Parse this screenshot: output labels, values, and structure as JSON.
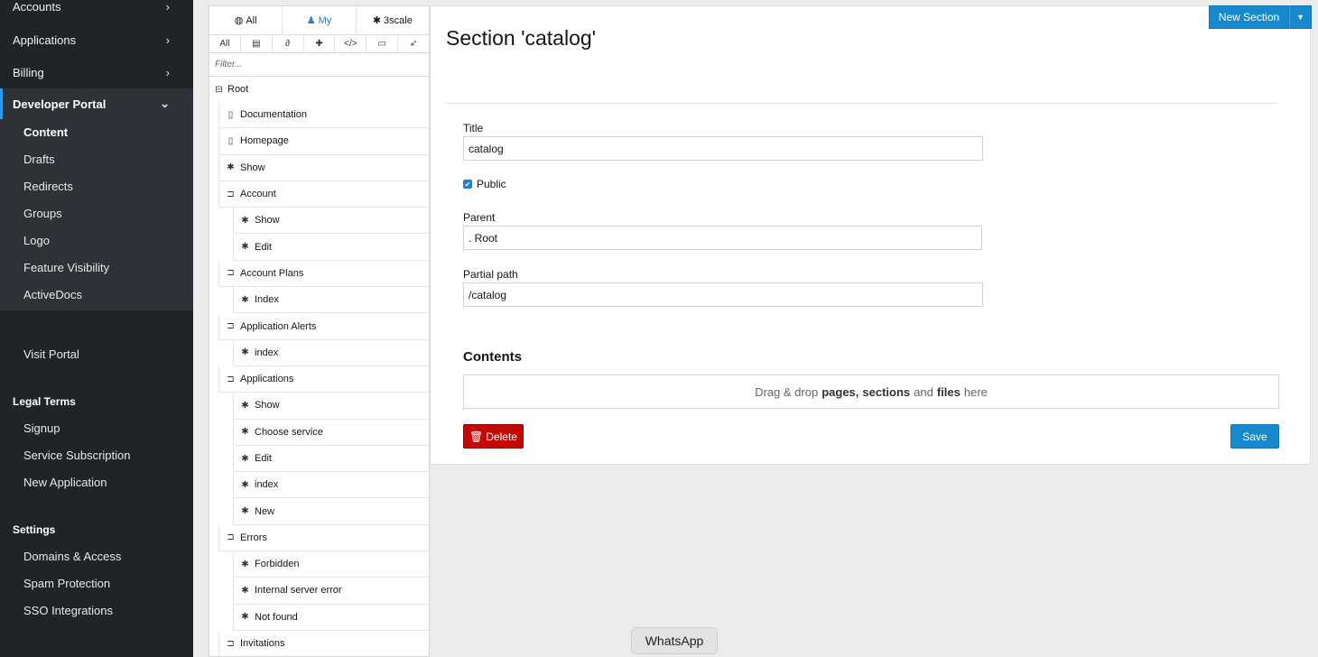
{
  "sidebar": {
    "top_items": [
      {
        "label": "Accounts"
      },
      {
        "label": "Applications"
      },
      {
        "label": "Billing"
      }
    ],
    "active_group": {
      "label": "Developer Portal",
      "items": [
        "Content",
        "Drafts",
        "Redirects",
        "Groups",
        "Logo",
        "Feature Visibility",
        "ActiveDocs"
      ]
    },
    "visit_portal": "Visit Portal",
    "legal_terms": {
      "title": "Legal Terms",
      "items": [
        "Signup",
        "Service Subscription",
        "New Application"
      ]
    },
    "settings": {
      "title": "Settings",
      "items": [
        "Domains & Access",
        "Spam Protection",
        "SSO Integrations"
      ]
    }
  },
  "tree": {
    "tabs": [
      {
        "label": "All",
        "icon": "globe-icon"
      },
      {
        "label": "My",
        "icon": "user-icon"
      },
      {
        "label": "3scale",
        "icon": "gear-icon"
      }
    ],
    "type_filters": [
      {
        "label": "All"
      },
      {
        "label": "",
        "icon": "page-icon"
      },
      {
        "label": "",
        "icon": "paperclip-icon"
      },
      {
        "label": "",
        "icon": "puzzle-icon"
      },
      {
        "label": "</>",
        "icon": "code-icon"
      },
      {
        "label": "",
        "icon": "folder-icon"
      },
      {
        "label": "",
        "icon": "rocket-icon"
      }
    ],
    "filter_placeholder": "Filter...",
    "root": "Root",
    "items": [
      {
        "label": "Documentation",
        "level": 1,
        "icon": "page-icon"
      },
      {
        "label": "Homepage",
        "level": 1,
        "icon": "page-icon"
      },
      {
        "label": "Show",
        "level": 1,
        "icon": "gear-icon"
      },
      {
        "label": "Account",
        "level": 1,
        "icon": "folder-open-icon"
      },
      {
        "label": "Show",
        "level": 2,
        "icon": "gear-icon"
      },
      {
        "label": "Edit",
        "level": 2,
        "icon": "gear-icon"
      },
      {
        "label": "Account Plans",
        "level": 1,
        "icon": "folder-open-icon"
      },
      {
        "label": "Index",
        "level": 2,
        "icon": "gear-icon"
      },
      {
        "label": "Application Alerts",
        "level": 1,
        "icon": "folder-open-icon"
      },
      {
        "label": "index",
        "level": 2,
        "icon": "gear-icon"
      },
      {
        "label": "Applications",
        "level": 1,
        "icon": "folder-open-icon"
      },
      {
        "label": "Show",
        "level": 2,
        "icon": "gear-icon"
      },
      {
        "label": "Choose service",
        "level": 2,
        "icon": "gear-icon"
      },
      {
        "label": "Edit",
        "level": 2,
        "icon": "gear-icon"
      },
      {
        "label": "index",
        "level": 2,
        "icon": "gear-icon"
      },
      {
        "label": "New",
        "level": 2,
        "icon": "gear-icon"
      },
      {
        "label": "Errors",
        "level": 1,
        "icon": "folder-open-icon"
      },
      {
        "label": "Forbidden",
        "level": 2,
        "icon": "gear-icon"
      },
      {
        "label": "Internal server error",
        "level": 2,
        "icon": "gear-icon"
      },
      {
        "label": "Not found",
        "level": 2,
        "icon": "gear-icon"
      },
      {
        "label": "Invitations",
        "level": 1,
        "icon": "folder-open-icon"
      }
    ]
  },
  "main": {
    "title": "Section 'catalog'",
    "new_section_label": "New Section",
    "form": {
      "title_label": "Title",
      "title_value": "catalog",
      "public_label": "Public",
      "public_checked": true,
      "parent_label": "Parent",
      "parent_value": ". Root",
      "partial_path_label": "Partial path",
      "partial_path_value": "/catalog"
    },
    "contents_title": "Contents",
    "dropzone": {
      "prefix": "Drag & drop",
      "pages": "pages,",
      "sections": "sections",
      "and": "and",
      "files": "files",
      "suffix": "here"
    },
    "delete_label": "Delete",
    "save_label": "Save"
  },
  "toast": {
    "label": "WhatsApp"
  },
  "colors": {
    "sidebar_bg": "#212427",
    "primary": "#1789ce",
    "danger": "#c60707"
  }
}
